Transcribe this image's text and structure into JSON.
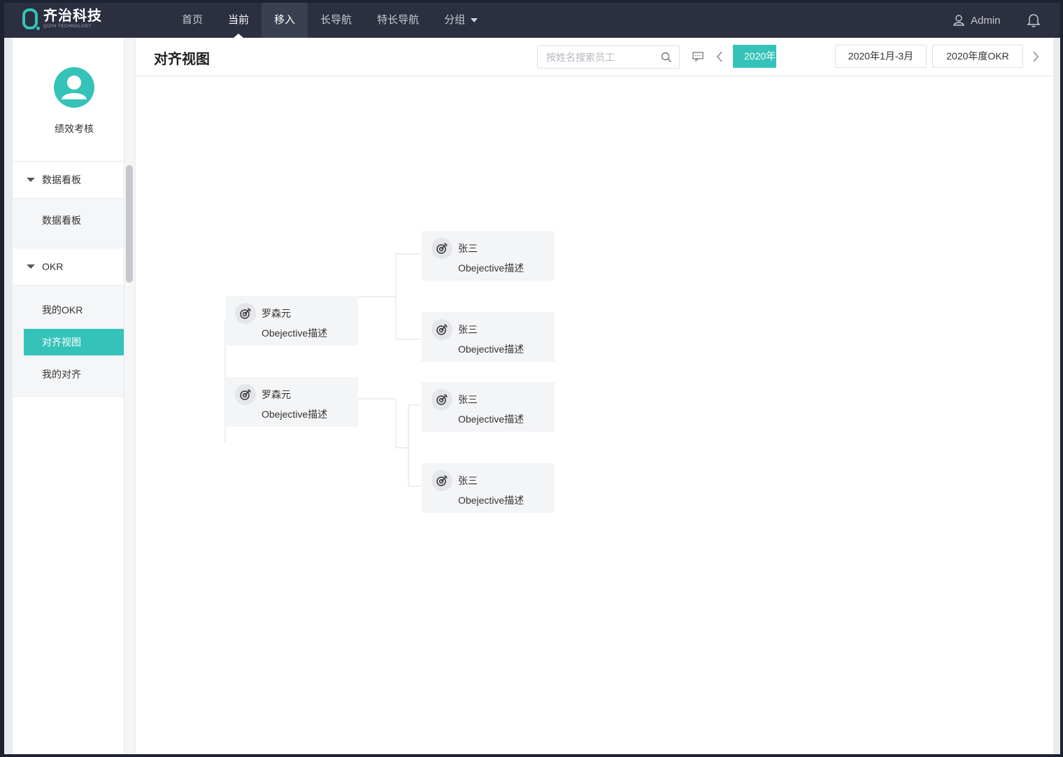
{
  "brand": {
    "name_cn": "齐治科技",
    "name_en": "QIZHI TECHNOLOGY",
    "accent": "#35c3b9"
  },
  "nav": {
    "items": [
      {
        "label": "首页"
      },
      {
        "label": "当前"
      },
      {
        "label": "移入"
      },
      {
        "label": "长导航"
      },
      {
        "label": "特长导航"
      },
      {
        "label": "分组"
      }
    ],
    "user": "Admin"
  },
  "sidebar": {
    "profile_name": "绩效考核",
    "groups": [
      {
        "label": "数据看板",
        "items": [
          {
            "label": "数据看板"
          }
        ]
      },
      {
        "label": "OKR",
        "items": [
          {
            "label": "我的OKR"
          },
          {
            "label": "对齐视图"
          },
          {
            "label": "我的对齐"
          }
        ]
      }
    ]
  },
  "main": {
    "title": "对齐视图",
    "search_placeholder": "按姓名搜索员工",
    "year": "2020年",
    "periods": [
      "2020年1月-3月",
      "2020年度OKR"
    ]
  },
  "tree": {
    "parents": [
      {
        "name": "罗森元",
        "desc": "Obejective描述",
        "children": [
          {
            "name": "张三",
            "desc": "Obejective描述"
          },
          {
            "name": "张三",
            "desc": "Obejective描述"
          }
        ]
      },
      {
        "name": "罗森元",
        "desc": "Obejective描述",
        "children": [
          {
            "name": "张三",
            "desc": "Obejective描述"
          },
          {
            "name": "张三",
            "desc": "Obejective描述"
          }
        ]
      }
    ]
  }
}
